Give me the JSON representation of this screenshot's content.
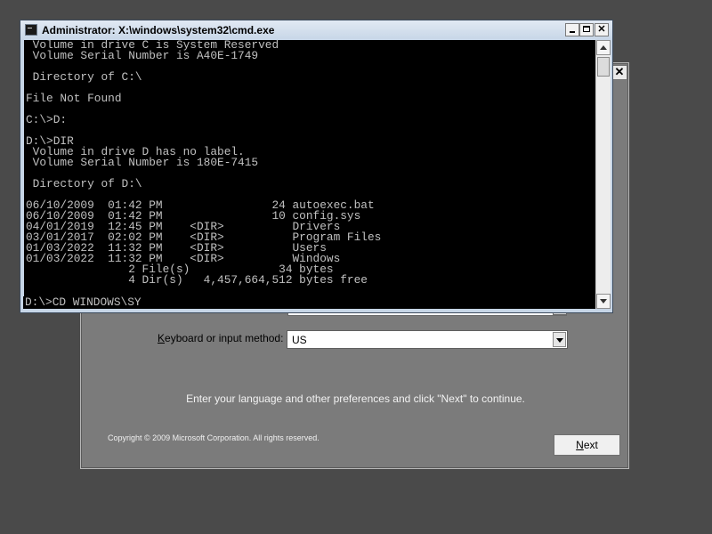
{
  "setup": {
    "close_label": "✕",
    "keyboard_label_prefix": "",
    "keyboard_label_accel": "K",
    "keyboard_label_rest": "eyboard or input method:",
    "keyboard_value": "US",
    "instruction": "Enter your language and other preferences and click \"Next\" to continue.",
    "copyright": "Copyright © 2009 Microsoft Corporation. All rights reserved.",
    "next_accel": "N",
    "next_rest": "ext"
  },
  "cmd": {
    "title": "Administrator: X:\\windows\\system32\\cmd.exe",
    "min_label": "",
    "max_label": "",
    "close_label": "✕",
    "lines": [
      " Volume in drive C is System Reserved",
      " Volume Serial Number is A40E-1749",
      "",
      " Directory of C:\\",
      "",
      "File Not Found",
      "",
      "C:\\>D:",
      "",
      "D:\\>DIR",
      " Volume in drive D has no label.",
      " Volume Serial Number is 180E-7415",
      "",
      " Directory of D:\\",
      "",
      "06/10/2009  01:42 PM                24 autoexec.bat",
      "06/10/2009  01:42 PM                10 config.sys",
      "04/01/2019  12:45 PM    <DIR>          Drivers",
      "03/01/2017  02:02 PM    <DIR>          Program Files",
      "01/03/2022  11:32 PM    <DIR>          Users",
      "01/03/2022  11:32 PM    <DIR>          Windows",
      "               2 File(s)             34 bytes",
      "               4 Dir(s)   4,457,664,512 bytes free"
    ],
    "prompt": "D:\\>CD WINDOWS\\SY"
  }
}
